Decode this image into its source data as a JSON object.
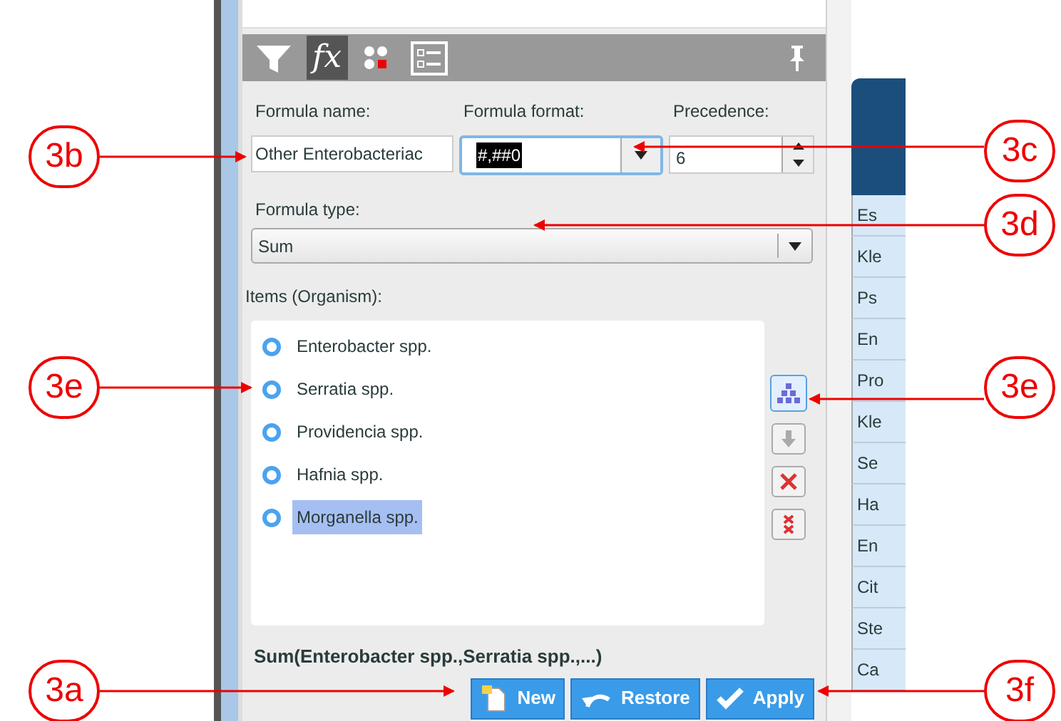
{
  "toolbar": {
    "tabs": [
      {
        "kind": "filter",
        "selected": false
      },
      {
        "kind": "formula",
        "label": "fx",
        "selected": true
      },
      {
        "kind": "dots",
        "selected": false
      },
      {
        "kind": "list",
        "selected": false
      }
    ]
  },
  "formula_name": {
    "label": "Formula name:",
    "value": "Other Enterobacteriac"
  },
  "formula_format": {
    "label": "Formula format:",
    "value": "#,##0"
  },
  "precedence": {
    "label": "Precedence:",
    "value": "6"
  },
  "formula_type": {
    "label": "Formula type:",
    "value": "Sum"
  },
  "items_label": "Items (Organism):",
  "items": [
    {
      "label": "Enterobacter spp.",
      "selected": false
    },
    {
      "label": "Serratia spp.",
      "selected": false
    },
    {
      "label": "Providencia spp.",
      "selected": false
    },
    {
      "label": "Hafnia spp.",
      "selected": false
    },
    {
      "label": "Morganella spp.",
      "selected": true
    }
  ],
  "expression": "Sum(Enterobacter spp.,Serratia spp.,...)",
  "buttons": [
    {
      "label": "New",
      "kind": "new"
    },
    {
      "label": "Restore",
      "kind": "restore"
    },
    {
      "label": "Apply",
      "kind": "apply"
    }
  ],
  "table": {
    "rows": [
      "Es",
      "Kle",
      "Ps",
      "En",
      "Pro",
      "Kle",
      "Se",
      "Ha",
      "En",
      "Cit",
      "Ste",
      "Ca"
    ]
  },
  "callouts": [
    {
      "label": "3b"
    },
    {
      "label": "3c"
    },
    {
      "label": "3d"
    },
    {
      "label": "3e"
    },
    {
      "label": "3e"
    },
    {
      "label": "3a"
    },
    {
      "label": "3f"
    }
  ]
}
